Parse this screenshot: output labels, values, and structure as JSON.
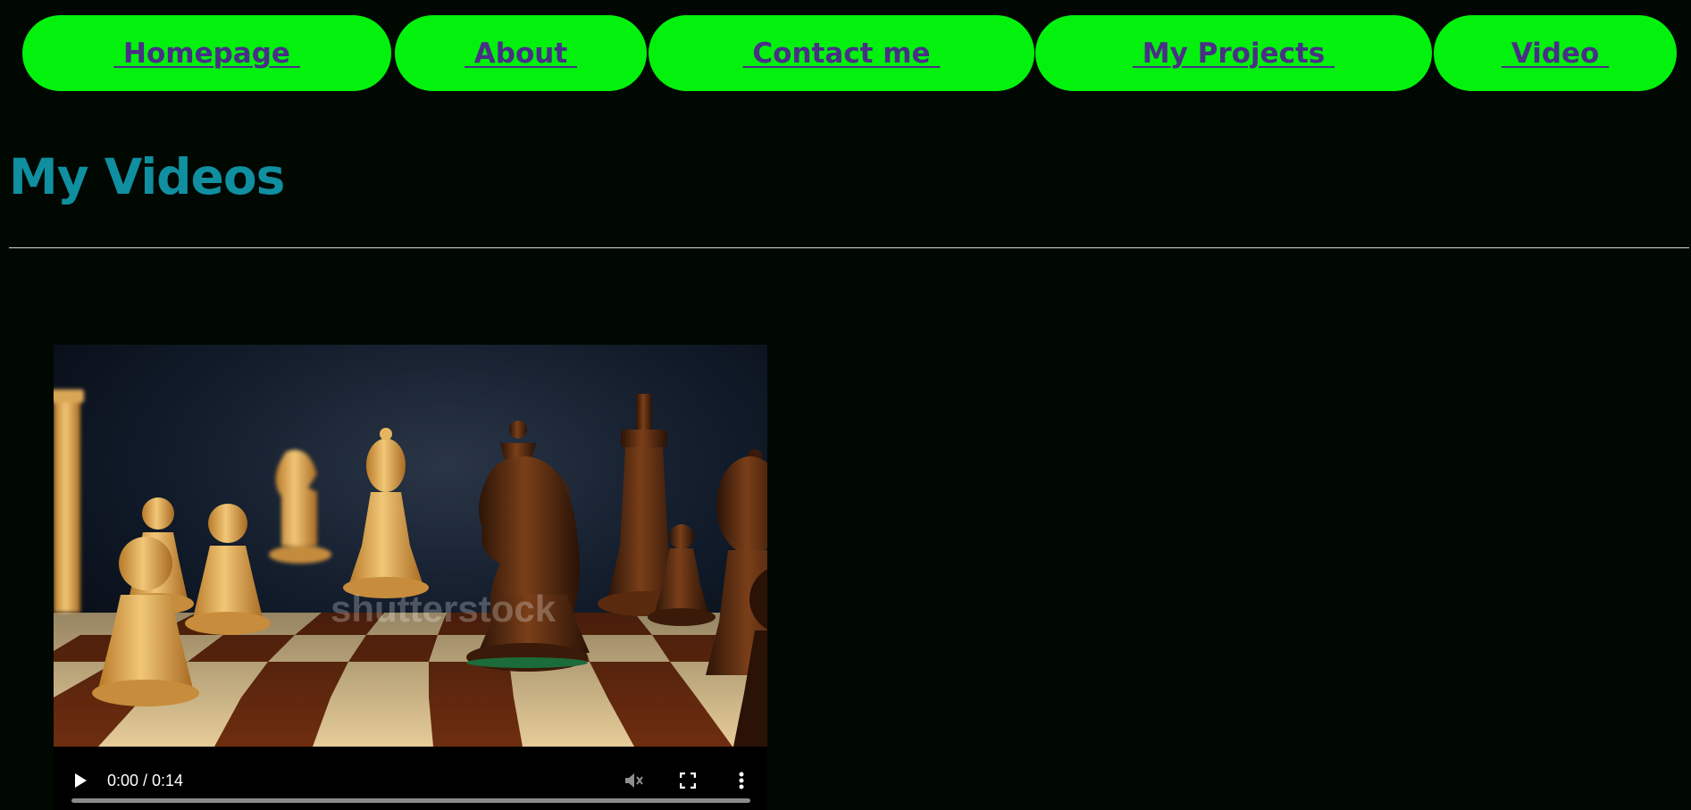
{
  "nav": {
    "items": [
      {
        "label": " Homepage "
      },
      {
        "label": " About "
      },
      {
        "label": " Contact me "
      },
      {
        "label": " My Projects "
      },
      {
        "label": " Video "
      }
    ]
  },
  "page": {
    "title": "My Videos"
  },
  "video": {
    "time_display": "0:00 / 0:14",
    "progress": 0,
    "watermark": "shutterstock",
    "icons": [
      "play-icon",
      "volume-muted-icon",
      "fullscreen-icon",
      "more-options-icon"
    ]
  },
  "colors": {
    "background": "#010801",
    "nav_pill": "#03f20d",
    "nav_text": "#4a2f86",
    "title": "#0f8fa0",
    "divider": "#d9d9d9"
  }
}
